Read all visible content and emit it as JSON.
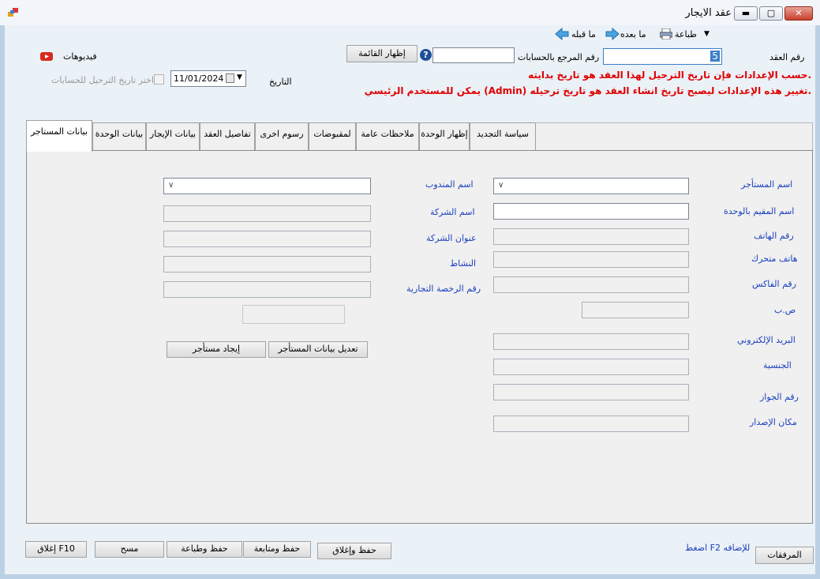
{
  "window": {
    "title": "عقد الايجار"
  },
  "toolbar": {
    "print": "طباعة",
    "next": "ما بعده",
    "prev": "ما قبله"
  },
  "header": {
    "contract_no_label": "رقم العقد",
    "contract_no_value": "5",
    "ref_label": "رقم المرجع بالحسابات",
    "ref_value": "",
    "show_list": "إظهار القائمة",
    "videos": "فيديوهات",
    "date_label": "التاريخ",
    "date_value": "11/01/2024",
    "posting_date_label": "اختر تاريخ الترحيل للحسابات",
    "warning_1": "حسب الإعدادات فإن تاريخ الترحيل لهذا العقد هو تاريخ بدايته.",
    "warning_2": "يمكن للمستخدم الرئيسي (Admin) تغيير هذه الإعدادات ليصبح تاريخ انشاء العقد هو تاريخ ترحيله."
  },
  "tabs": [
    {
      "label": "بيانات المستاجر",
      "active": true
    },
    {
      "label": "بيانات الوحدة"
    },
    {
      "label": "بيانات الإيجار"
    },
    {
      "label": "تفاصيل العقد"
    },
    {
      "label": "رسوم اخرى"
    },
    {
      "label": "لمقبوضات"
    },
    {
      "label": "ملاحظات عامة"
    },
    {
      "label": "إظهار الوحدة"
    },
    {
      "label": "سياسة التجديد"
    }
  ],
  "tenant": {
    "tenant_name": "اسم المستأجر",
    "resident_name": "اسم المقيم بالوحدة",
    "phone": "رقم الهاتف",
    "mobile": "هاتف متحرك",
    "fax": "رقم الفاكس",
    "po_box": "ص.ب",
    "email": "البريد الإلكتروني",
    "nationality": "الجنسية",
    "passport": "رقم الجواز",
    "issue_place": "مكان الإصدار",
    "delegate_name": "اسم المندوب",
    "company_name": "اسم الشركة",
    "company_address": "عنوان الشركة",
    "activity": "النشاط",
    "license_no": "رقم الرخصة التجارية",
    "edit_tenant": "تعديل بيانات المستأجر",
    "find_tenant": "إيجاد مستأجر"
  },
  "footer": {
    "attachments": "المرفقات",
    "f2_hint": "اضغط F2 للإضافه",
    "save_close": "حفظ وإغلاق",
    "save_continue": "حفظ ومتابعة",
    "save_print": "حفظ وطباعة",
    "clear": "مسح",
    "close": "إغلاق F10"
  },
  "colors": {
    "warning": "#e00000",
    "label_blue": "#1a3fbf",
    "youtube": "#d62a1e"
  }
}
